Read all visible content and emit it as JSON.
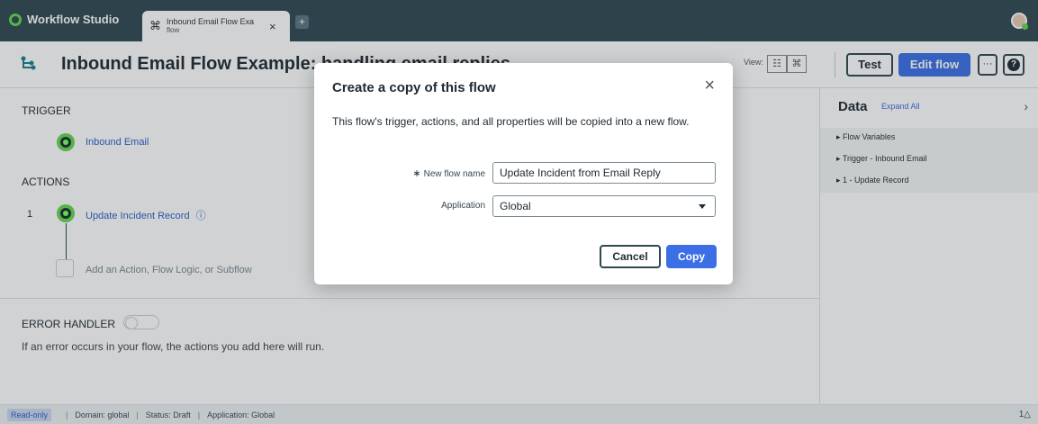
{
  "app": {
    "name": "Workflow Studio"
  },
  "tabs": [
    {
      "title": "Inbound Email Flow Exa",
      "subtitle": "flow",
      "close": "×"
    }
  ],
  "new_tab": "+",
  "header": {
    "title": "Inbound Email Flow Example: handling email replies",
    "view_label": "View:",
    "test_label": "Test",
    "edit_label": "Edit flow",
    "more_label": "···",
    "help_label": "?"
  },
  "flow": {
    "trigger_label": "TRIGGER",
    "trigger_name": "Inbound Email",
    "actions_label": "ACTIONS",
    "actions": [
      {
        "number": "1",
        "name": "Update Incident Record",
        "info": "ⓘ"
      }
    ],
    "add_action_text": "Add an Action, Flow Logic, or Subflow",
    "error_handler_label": "ERROR HANDLER",
    "error_handler_desc": "If an error occurs in your flow, the actions you add here will run."
  },
  "data_panel": {
    "title": "Data",
    "expand_all": "Expand All",
    "items": [
      {
        "label": "▸ Flow Variables"
      },
      {
        "label": "▸ Trigger - Inbound Email"
      },
      {
        "label": "▸ 1 - Update Record"
      }
    ]
  },
  "modal": {
    "title": "Create a copy of this flow",
    "description": "This flow's trigger, actions, and all properties will be copied into a new flow.",
    "name_label": "New flow name",
    "name_value": "Update Incident from Email Reply",
    "application_label": "Application",
    "application_value": "Global",
    "cancel_label": "Cancel",
    "copy_label": "Copy",
    "close": "×",
    "required_marker": "∗"
  },
  "status_bar": {
    "readonly": "Read-only",
    "domain": "Domain: global",
    "status": "Status: Draft",
    "application": "Application: Global",
    "right": "1△"
  },
  "colors": {
    "topbar": "#2f4750",
    "accent": "#3c6fe6",
    "node": "#62d84e"
  }
}
